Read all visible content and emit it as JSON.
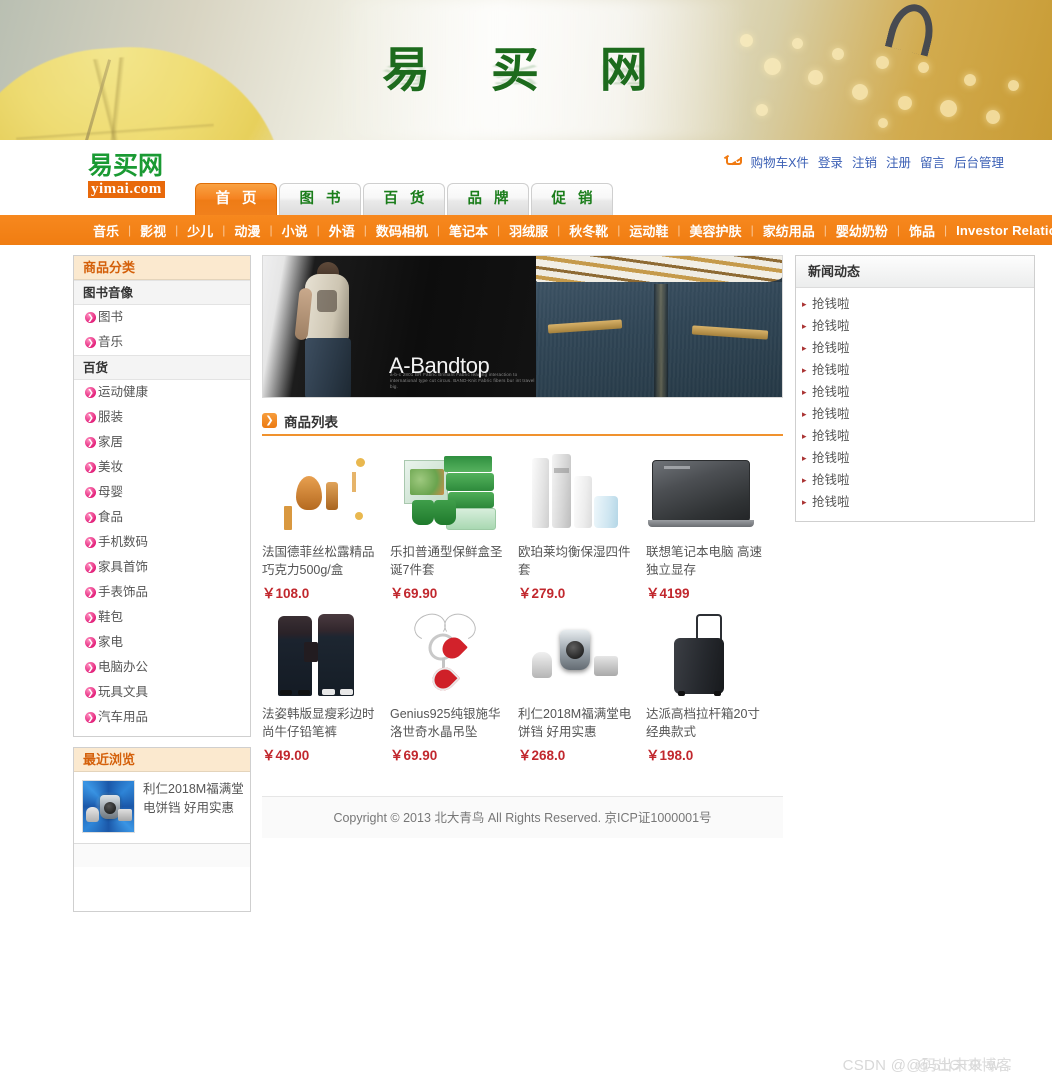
{
  "banner": {
    "title": "易 买 网"
  },
  "logo": {
    "cn": "易买网",
    "en": "yimai.com"
  },
  "toplinks": {
    "cart_icon": "shopping-cart-icon",
    "items": [
      {
        "label": "购物车X件"
      },
      {
        "label": "登录"
      },
      {
        "label": "注销"
      },
      {
        "label": "注册"
      },
      {
        "label": "留言"
      },
      {
        "label": "后台管理"
      }
    ]
  },
  "tabs": [
    {
      "label": "首 页",
      "active": true
    },
    {
      "label": "图 书",
      "active": false
    },
    {
      "label": "百 货",
      "active": false
    },
    {
      "label": "品 牌",
      "active": false
    },
    {
      "label": "促 销",
      "active": false
    }
  ],
  "subnav": [
    "音乐",
    "影视",
    "少儿",
    "动漫",
    "小说",
    "外语",
    "数码相机",
    "笔记本",
    "羽绒服",
    "秋冬靴",
    "运动鞋",
    "美容护肤",
    "家纺用品",
    "婴幼奶粉",
    "饰品",
    "Investor Relations"
  ],
  "sidebar": {
    "categories_title": "商品分类",
    "groups": [
      {
        "name": "图书音像",
        "items": [
          "图书",
          "音乐"
        ]
      },
      {
        "name": "百货",
        "items": [
          "运动健康",
          "服装",
          "家居",
          "美妆",
          "母婴",
          "食品",
          "手机数码",
          "家具首饰",
          "手表饰品",
          "鞋包",
          "家电",
          "电脑办公",
          "玩具文具",
          "汽车用品"
        ]
      }
    ],
    "recent_title": "最近浏览",
    "recent_item": {
      "name": "利仁2018M福满堂电饼铛 好用实惠",
      "thumb": "cooker-thumbnail"
    }
  },
  "hero": {
    "brand": "A-Bandtop",
    "subtext": "a-b-c 2801 BR Fabric Brilliant Fabric leading interaction to international type cut circus. BAND-Knit Fabric fibers bur int travel big."
  },
  "product_list": {
    "title": "商品列表",
    "icon": "chevron-right-square-icon",
    "products": [
      {
        "name": "法国德菲丝松露精品巧克力500g/盒",
        "price": "￥108.0",
        "art": "pa-choc"
      },
      {
        "name": "乐扣普通型保鲜盒圣诞7件套",
        "price": "￥69.90",
        "art": "pa-box"
      },
      {
        "name": "欧珀莱均衡保湿四件套",
        "price": "￥279.0",
        "art": "pa-cos"
      },
      {
        "name": "联想笔记本电脑 高速独立显存",
        "price": "￥4199",
        "art": "pa-laptop"
      },
      {
        "name": "法姿韩版显瘦彩边时尚牛仔铅笔裤",
        "price": "￥49.00",
        "art": "pa-jeans"
      },
      {
        "name": "Genius925纯银施华洛世奇水晶吊坠",
        "price": "￥69.90",
        "art": "pa-neck"
      },
      {
        "name": "利仁2018M福满堂电饼铛 好用实惠",
        "price": "￥268.0",
        "art": "pa-cook"
      },
      {
        "name": "达派高档拉杆箱20寸 经典款式",
        "price": "￥198.0",
        "art": "pa-lug"
      }
    ]
  },
  "news": {
    "title": "新闻动态",
    "items": [
      "抢钱啦",
      "抢钱啦",
      "抢钱啦",
      "抢钱啦",
      "抢钱啦",
      "抢钱啦",
      "抢钱啦",
      "抢钱啦",
      "抢钱啦",
      "抢钱啦"
    ]
  },
  "footer": {
    "text": "Copyright © 2013 北大青鸟 All Rights Reserved. 京ICP证1000001号"
  },
  "watermark": {
    "text1": "CSDN @@码出未来-w...",
    "text2": "@51CTO博客"
  },
  "colors": {
    "orange": "#f0801c",
    "green": "#1a7d1a",
    "price_red": "#c1272d",
    "link_blue": "#3a5fb5",
    "banner_green": "#1d6b1d"
  }
}
